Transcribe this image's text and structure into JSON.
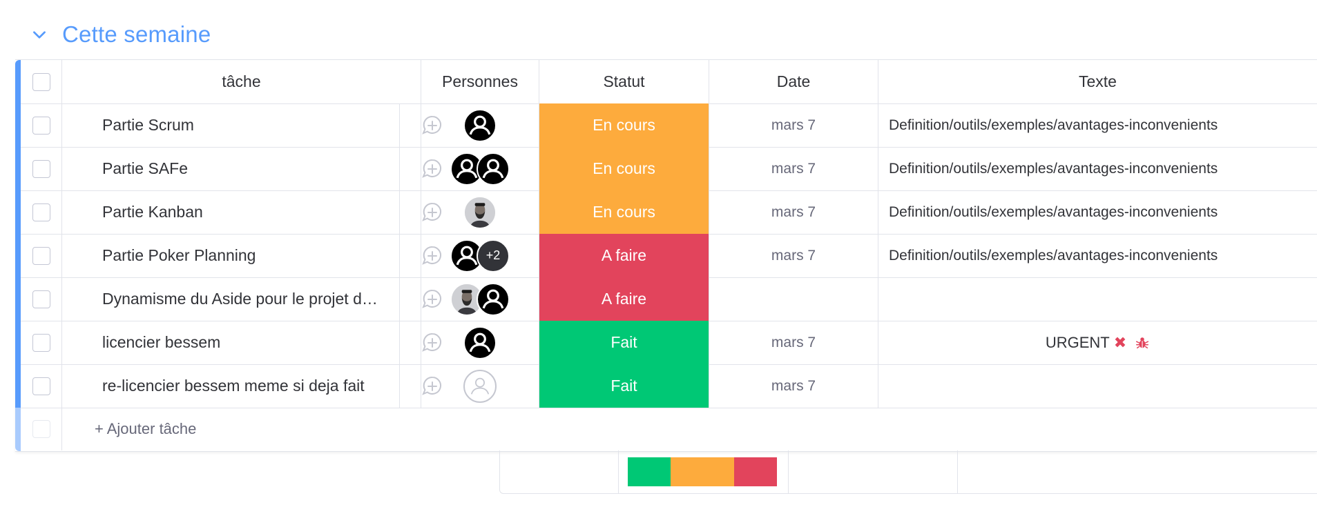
{
  "group": {
    "title": "Cette semaine",
    "color": "#579bfc"
  },
  "columns": {
    "task": "tâche",
    "people": "Personnes",
    "status": "Statut",
    "date": "Date",
    "text": "Texte"
  },
  "colors": {
    "working": "#fdab3d",
    "stuck": "#e2445c",
    "done": "#00c875"
  },
  "rows": [
    {
      "task": "Partie Scrum",
      "people": [
        "person"
      ],
      "status": "En cours",
      "status_color": "#fdab3d",
      "date": "mars 7",
      "text": "Definition/outils/exemples/avantages-inconvenients"
    },
    {
      "task": "Partie SAFe",
      "people": [
        "person",
        "person"
      ],
      "status": "En cours",
      "status_color": "#fdab3d",
      "date": "mars 7",
      "text": "Definition/outils/exemples/avantages-inconvenients"
    },
    {
      "task": "Partie Kanban",
      "people": [
        "photo"
      ],
      "status": "En cours",
      "status_color": "#fdab3d",
      "date": "mars 7",
      "text": "Definition/outils/exemples/avantages-inconvenients"
    },
    {
      "task": "Partie Poker Planning",
      "people": [
        "person",
        "+2"
      ],
      "status": "A faire",
      "status_color": "#e2445c",
      "date": "mars 7",
      "text": "Definition/outils/exemples/avantages-inconvenients"
    },
    {
      "task": "Dynamisme du Aside pour le projet du site",
      "people": [
        "photo",
        "person"
      ],
      "status": "A faire",
      "status_color": "#e2445c",
      "date": "",
      "text": ""
    },
    {
      "task": "licencier bessem",
      "people": [
        "person"
      ],
      "status": "Fait",
      "status_color": "#00c875",
      "date": "mars 7",
      "text": "URGENT"
    },
    {
      "task": "re-licencier bessem meme si deja fait",
      "people": [
        "empty"
      ],
      "status": "Fait",
      "status_color": "#00c875",
      "date": "mars 7",
      "text": ""
    }
  ],
  "add_task": {
    "label": "+ Ajouter tâche"
  },
  "summary": {
    "status_distribution": [
      {
        "label": "Fait",
        "fraction": 0.2857,
        "color": "#00c875"
      },
      {
        "label": "En cours",
        "fraction": 0.4286,
        "color": "#fdab3d"
      },
      {
        "label": "A faire",
        "fraction": 0.2857,
        "color": "#e2445c"
      }
    ]
  }
}
